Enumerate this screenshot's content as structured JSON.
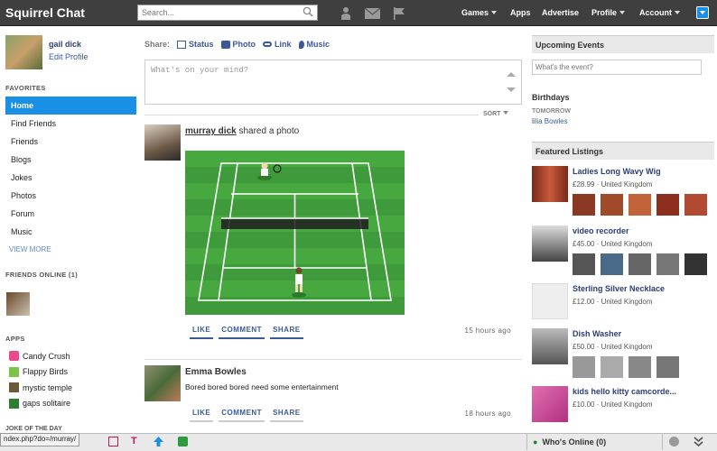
{
  "app": {
    "title": "Squirrel Chat"
  },
  "search": {
    "placeholder": "Search..."
  },
  "nav": {
    "games": "Games",
    "apps": "Apps",
    "advertise": "Advertise",
    "profile": "Profile",
    "account": "Account"
  },
  "user": {
    "name": "gail dick",
    "edit_profile": "Edit Profile"
  },
  "favorites": {
    "heading": "FAVORITES",
    "items": [
      "Home",
      "Find Friends",
      "Friends",
      "Blogs",
      "Jokes",
      "Photos",
      "Forum",
      "Music"
    ],
    "view_more": "VIEW MORE"
  },
  "friends_online": {
    "heading": "FRIENDS ONLINE (1)"
  },
  "apps_section": {
    "heading": "APPS",
    "items": [
      "Candy Crush",
      "Flappy Birds",
      "mystic temple",
      "gaps solitaire"
    ]
  },
  "joke": {
    "heading": "JOKE OF THE DAY"
  },
  "share": {
    "label": "Share:",
    "status": "Status",
    "photo": "Photo",
    "link": "Link",
    "music": "Music",
    "placeholder": "What's on your mind?"
  },
  "sort": {
    "label": "SORT"
  },
  "posts": [
    {
      "author": "murray dick",
      "action": " shared a photo",
      "actions": [
        "LIKE",
        "COMMENT",
        "SHARE"
      ],
      "time": "15 hours ago"
    },
    {
      "author": "Emma Bowles",
      "text": "Bored bored bored need some entertainment",
      "actions": [
        "LIKE",
        "COMMENT",
        "SHARE"
      ],
      "time": "18 hours ago"
    }
  ],
  "events": {
    "heading": "Upcoming Events",
    "placeholder": "What's the event?"
  },
  "birthdays": {
    "heading": "Birthdays",
    "when": "TOMORROW",
    "name": "lilia Bowles"
  },
  "featured": {
    "heading": "Featured Listings",
    "items": [
      {
        "title": "Ladies Long Wavy Wig",
        "price": "£28.99",
        "location": "United Kingdom"
      },
      {
        "title": "video recorder",
        "price": "£45.00",
        "location": "United Kingdom"
      },
      {
        "title": "Sterling Silver Necklace",
        "price": "£12.00",
        "location": "United Kingdom"
      },
      {
        "title": "Dish Washer",
        "price": "£50.00",
        "location": "United Kingdom"
      },
      {
        "title": "kids hello kitty camcorde...",
        "price": "£10.00",
        "location": "United Kingdom"
      }
    ]
  },
  "bottom": {
    "url": "ndex.php?do=/murray/",
    "whos_online": "Who's Online (0)"
  },
  "colors": {
    "accent": "#1a8fe6",
    "link": "#3b5998",
    "topbar": "#3f3f3f"
  }
}
